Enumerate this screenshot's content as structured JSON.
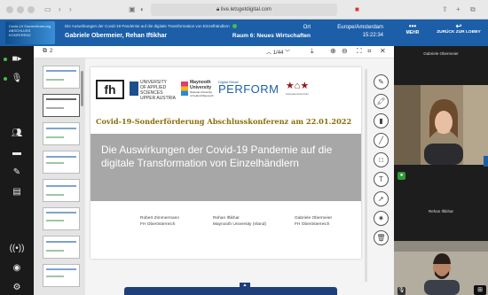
{
  "browser": {
    "url": "live.letsgetdigital.com"
  },
  "header": {
    "logo_text": "Covid-19 Sonderförderung ABSCHLUSS KONFERENZ",
    "subtitle": "Die Auswirkungen der Covid-19 Pandemie auf die digitale Transformation von Einzelhändlern",
    "speakers": "Gabriele Obermeier, Rehan Iftikhar",
    "location_label": "Ort",
    "room": "Raum 6: Neues Wirtschaften",
    "timezone": "Europe/Amsterdam",
    "time": "15:22:34",
    "more_label": "MEHR",
    "back_label": "ZURÜCK ZUR LOBBY"
  },
  "presentation": {
    "page_count": "2",
    "page_indicator": "1/44",
    "slide": {
      "logo_fh": "fh",
      "logo_uas_line1": "UNIVERSITY",
      "logo_uas_line2": "OF APPLIED SCIENCES",
      "logo_uas_line3": "UPPER AUSTRIA",
      "logo_maynooth_line1": "Maynooth",
      "logo_maynooth_line2": "University",
      "logo_maynooth_line3": "National University of Ireland Maynooth",
      "logo_perform_small": "Digital Retail",
      "logo_perform": "PERFORM",
      "logo_house_caption": "Kompetenzzentrum",
      "title": "Covid-19-Sonderförderung Abschlusskonferenz am 22.01.2022",
      "headline": "Die Auswirkungen der Covid-19 Pandemie auf die digitale Transformation von Einzelhändlern",
      "authors": [
        {
          "name": "Robert Zimmermann",
          "affiliation": "FH Oberösterreich"
        },
        {
          "name": "Rehan Iftikhar",
          "affiliation": "Maynooth University (Irland)"
        },
        {
          "name": "Gabriele Obermeier",
          "affiliation": "FH Oberösterreich"
        }
      ]
    }
  },
  "participants": [
    {
      "name": "Gabriele Obermeier"
    },
    {
      "name": "Rehan Iftikhar"
    }
  ],
  "colors": {
    "header_blue": "#1c5fa8",
    "title_gold": "#8a6d0a",
    "band_grey": "#a7a7a7",
    "live_green": "#41c04a"
  }
}
